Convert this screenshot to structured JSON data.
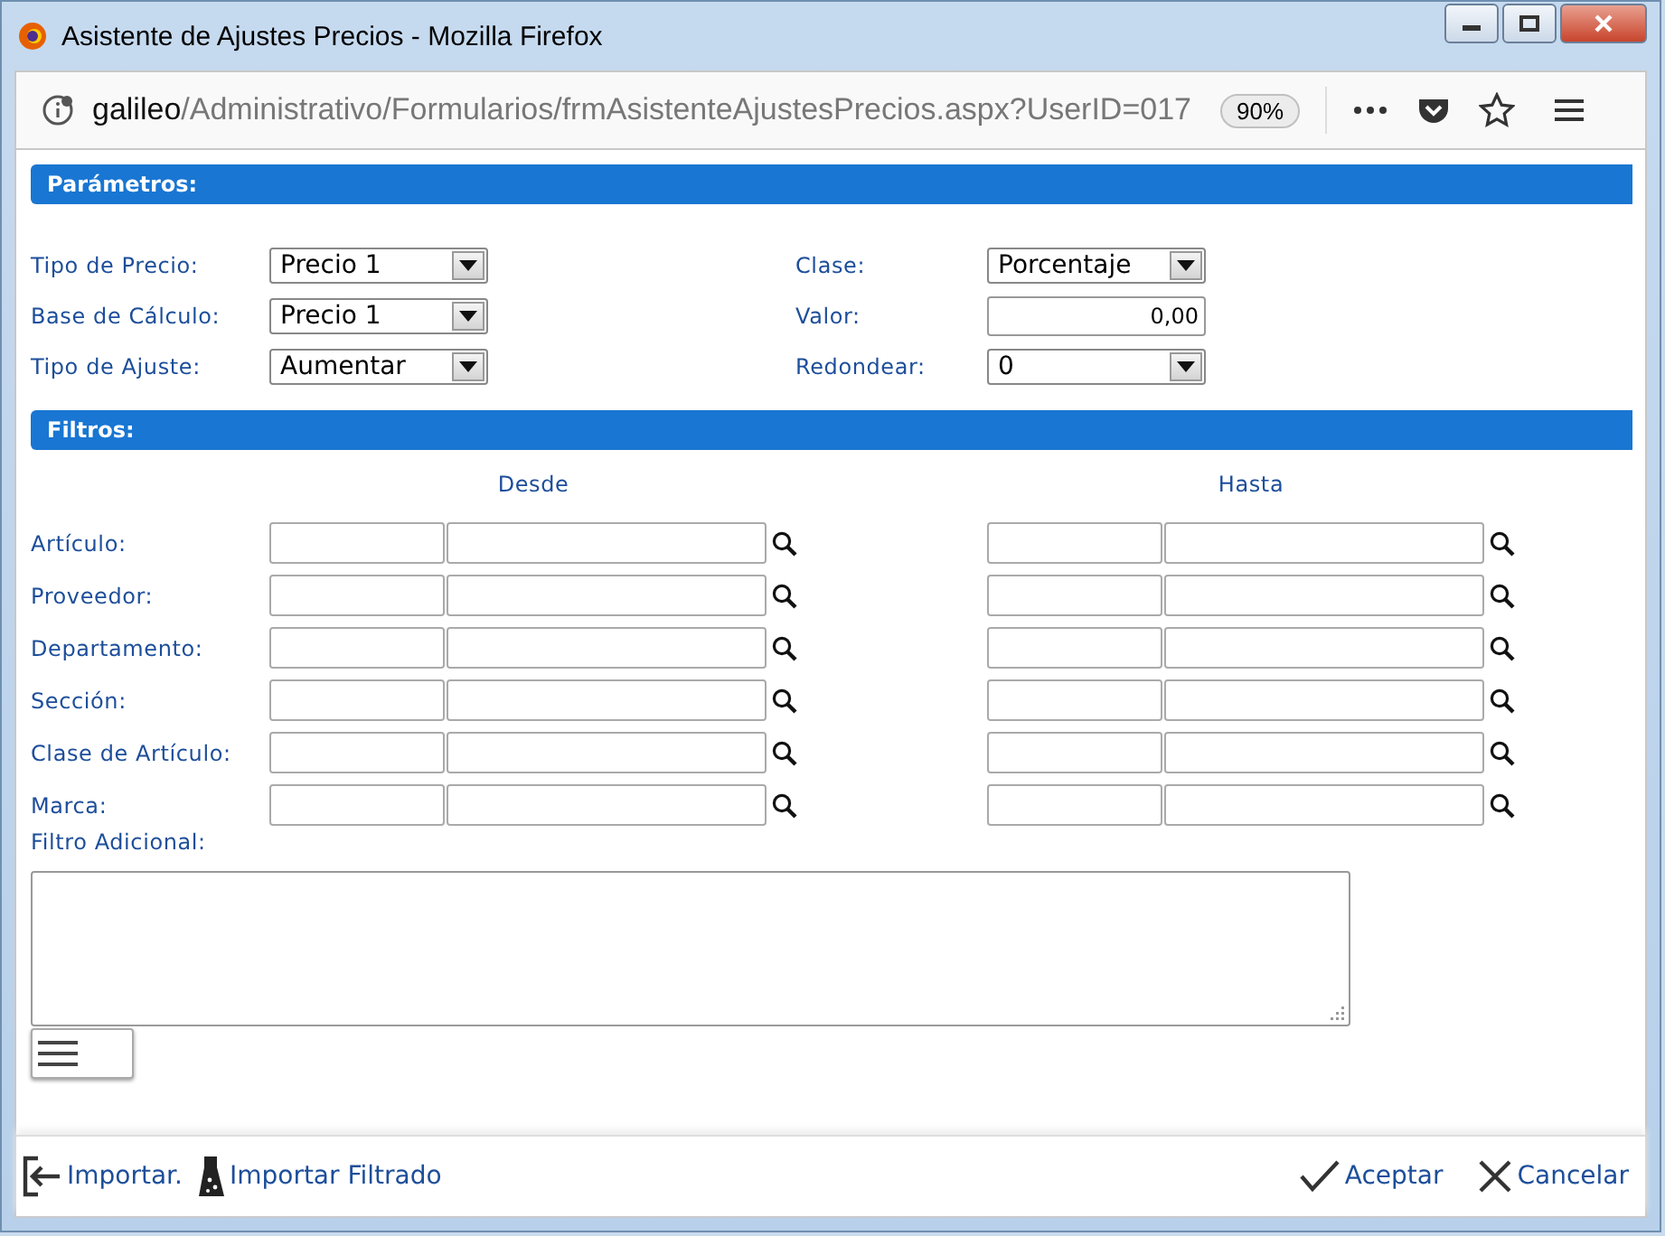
{
  "window": {
    "title": "Asistente de Ajustes Precios - Mozilla Firefox"
  },
  "address_bar": {
    "host": "galileo",
    "path": "/Administrativo/Formularios/frmAsistenteAjustesPrecios.aspx?UserID=017",
    "zoom": "90%"
  },
  "parameters": {
    "title": "Parámetros:",
    "left": [
      {
        "label": "Tipo de Precio:",
        "kind": "select",
        "value": "Precio 1"
      },
      {
        "label": "Base de Cálculo:",
        "kind": "select",
        "value": "Precio 1"
      },
      {
        "label": "Tipo de Ajuste:",
        "kind": "select",
        "value": "Aumentar"
      }
    ],
    "right": [
      {
        "label": "Clase:",
        "kind": "select",
        "value": "Porcentaje"
      },
      {
        "label": "Valor:",
        "kind": "input",
        "value": "0,00"
      },
      {
        "label": "Redondear:",
        "kind": "select",
        "value": "0"
      }
    ]
  },
  "filters": {
    "title": "Filtros:",
    "from_header": "Desde",
    "to_header": "Hasta",
    "rows": [
      {
        "label": "Artículo:"
      },
      {
        "label": "Proveedor:"
      },
      {
        "label": "Departamento:"
      },
      {
        "label": "Sección:"
      },
      {
        "label": "Clase de Artículo:"
      },
      {
        "label": "Marca:"
      }
    ],
    "additional_label": "Filtro Adicional:"
  },
  "footer": {
    "left_actions": [
      {
        "kind": "import",
        "label": "Importar."
      },
      {
        "kind": "filter",
        "label": "Importar Filtrado"
      }
    ],
    "right_actions": [
      {
        "kind": "accept",
        "label": "Aceptar"
      },
      {
        "kind": "cancel",
        "label": "Cancelar"
      }
    ]
  }
}
